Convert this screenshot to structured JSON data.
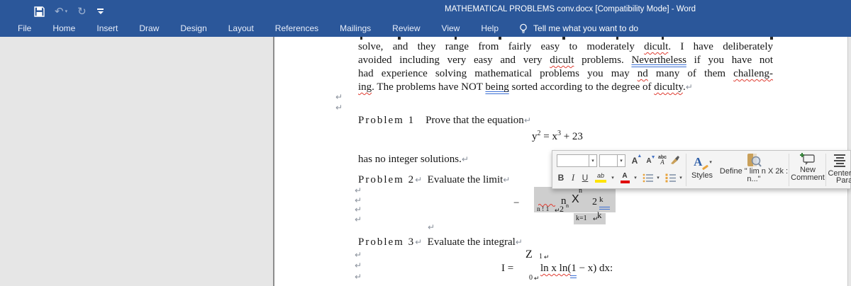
{
  "titlebar": {
    "title": "MATHEMATICAL PROBLEMS conv.docx [Compatibility Mode]  -  Word",
    "tell_me": "Tell me what you want to do"
  },
  "icons": {
    "caret_down": "▾",
    "undo": "↶",
    "redo": "↻"
  },
  "ribbon_tabs": [
    "File",
    "Home",
    "Insert",
    "Draw",
    "Design",
    "Layout",
    "References",
    "Mailings",
    "Review",
    "View",
    "Help"
  ],
  "document": {
    "pilcrow": "↵",
    "para": {
      "line1": [
        {
          "t": "solve, and they range from fairly easy to moderately "
        },
        {
          "t": "dicult",
          "m": "sp"
        },
        {
          "t": ". I have deliberately"
        }
      ],
      "line2": [
        {
          "t": "avoided including very easy and very "
        },
        {
          "t": "dicult",
          "m": "sp"
        },
        {
          "t": " problems. "
        },
        {
          "t": "Nevertheless",
          "m": "gr"
        },
        {
          "t": " if you have not"
        }
      ],
      "line3": [
        {
          "t": "had experience solving mathematical problems you may "
        },
        {
          "t": "nd",
          "m": "sp"
        },
        {
          "t": " many of them "
        },
        {
          "t": "challeng-",
          "m": "sp"
        }
      ],
      "line4": [
        {
          "t": "ing",
          "m": "sp"
        },
        {
          "t": ". The problems have NOT "
        },
        {
          "t": "being",
          "m": "gr"
        },
        {
          "t": " sorted according to the degree of "
        },
        {
          "t": "diculty",
          "m": "sp"
        },
        {
          "t": "."
        },
        {
          "t": "↵",
          "m": "pc"
        }
      ]
    },
    "p1_heading": [
      {
        "t": "Problem 1",
        "m": "lbl"
      },
      {
        "t": "    "
      },
      {
        "t": "Prove that the equation"
      },
      {
        "t": "↵",
        "m": "pc"
      }
    ],
    "equation1": [
      {
        "t": "y"
      },
      {
        "t": "2",
        "m": "sup"
      },
      {
        "t": " = x"
      },
      {
        "t": "3",
        "m": "sup"
      },
      {
        "t": " + 23"
      }
    ],
    "p1_tail": [
      {
        "t": "has no integer solutions."
      },
      {
        "t": "↵",
        "m": "pc"
      }
    ],
    "p2_heading": [
      {
        "t": "Problem 2",
        "m": "lbl"
      },
      {
        "t": "↵",
        "m": "pc"
      },
      {
        "t": "  Evaluate the limit"
      },
      {
        "t": "↵",
        "m": "pc"
      }
    ],
    "p3_heading": [
      {
        "t": "Problem 3",
        "m": "lbl"
      },
      {
        "t": "↵",
        "m": "pc"
      },
      {
        "t": "  Evaluate the integral"
      },
      {
        "t": "↵",
        "m": "pc"
      }
    ],
    "formula2": {
      "minus": "−",
      "sup_n": "n",
      "big_n": "n",
      "x": "X",
      "two": "2",
      "k_sup": "k",
      "lim_text": "n ! 1",
      "two_base": "2",
      "two_sup": "n",
      "k_low": "k",
      "k_eq": "k=1"
    },
    "formula3": {
      "z": "Z",
      "upper": "1",
      "lhs": "I =",
      "integrand_a": "ln x ln(",
      "integrand_b": "1 − x) dx:",
      "lower": "0"
    }
  },
  "mini_toolbar": {
    "font_name_value": "",
    "font_size_value": "",
    "grow": "A",
    "shrink": "A",
    "abc_top": "abc",
    "abc_bottom": "A",
    "bold": "B",
    "italic": "I",
    "underline": "U",
    "highlight": "ab",
    "font_color": "A",
    "styles_a": "A",
    "styles_label": "Styles",
    "define_line1": "Define \" lim n X 2k :",
    "define_line2": "n...\"",
    "comment_line1": "New",
    "comment_line2": "Comment",
    "center_label": "Center",
    "para_label": "Para"
  },
  "colors": {
    "titlebar_blue": "#2b579a",
    "canvas_gray": "#e6e6e6",
    "selection_gray": "#cecece",
    "spell_red": "#e03c31",
    "grammar_blue": "#3b6fd4",
    "highlight_yellow": "#ffe400",
    "font_color_red": "#e00000"
  }
}
